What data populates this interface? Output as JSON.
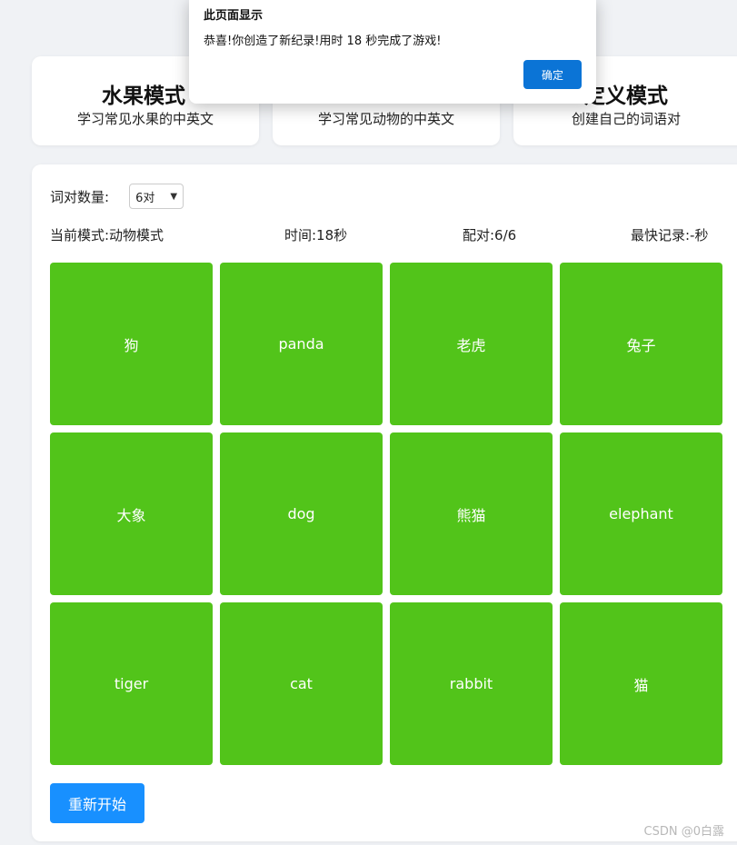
{
  "modes": [
    {
      "title": "水果模式",
      "desc": "学习常见水果的中英文"
    },
    {
      "title": "",
      "desc": "学习常见动物的中英文"
    },
    {
      "title": "定义模式",
      "desc": "创建自己的词语对"
    }
  ],
  "settings": {
    "pair_count_label": "词对数量:",
    "pair_count_value": "6对"
  },
  "status": {
    "mode": "当前模式:动物模式",
    "time": "时间:18秒",
    "pairs": "配对:6/6",
    "best": "最快记录:-秒"
  },
  "cards": [
    "狗",
    "panda",
    "老虎",
    "兔子",
    "大象",
    "dog",
    "熊猫",
    "elephant",
    "tiger",
    "cat",
    "rabbit",
    "猫"
  ],
  "buttons": {
    "restart": "重新开始"
  },
  "dialog": {
    "title": "此页面显示",
    "message": "恭喜!你创造了新纪录!用时 18 秒完成了游戏!",
    "ok": "确定"
  },
  "watermark": "CSDN @0白露",
  "colors": {
    "card_matched": "#52c41a",
    "primary": "#1890ff",
    "dialog_button": "#0b74d6"
  }
}
